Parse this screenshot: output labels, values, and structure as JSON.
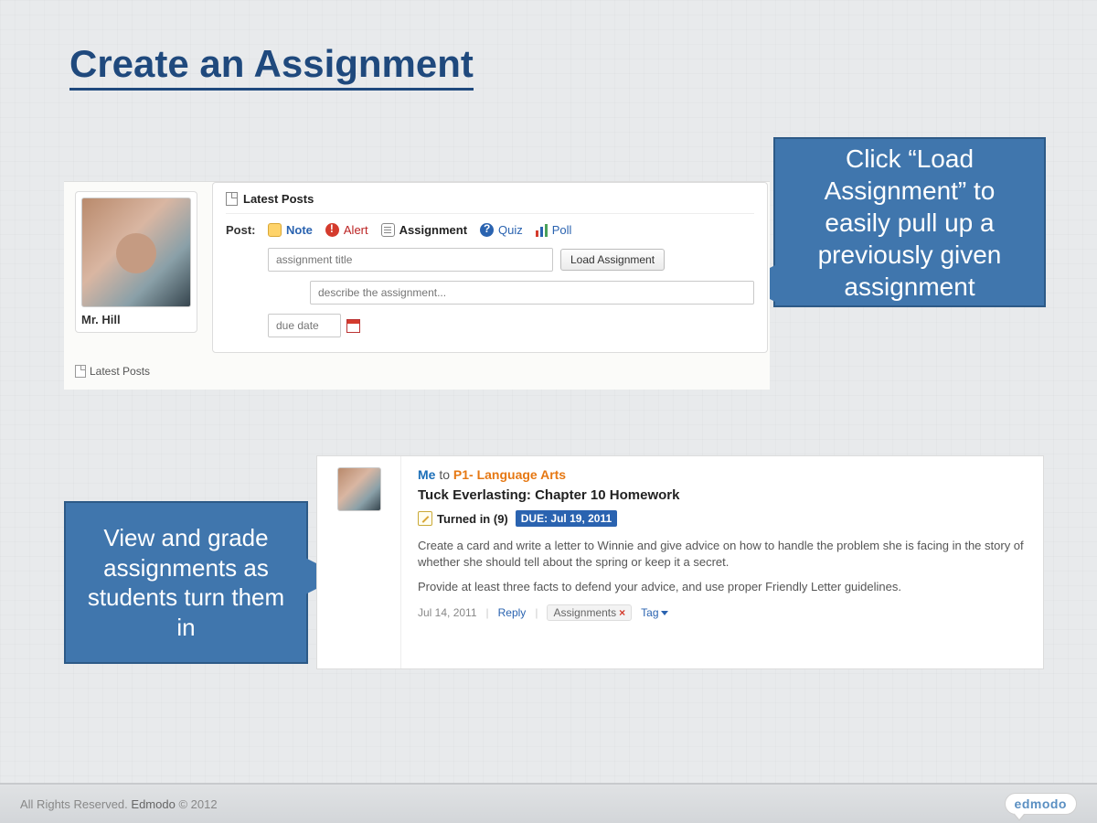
{
  "slide": {
    "title": "Create an Assignment"
  },
  "callouts": {
    "load": "Click “Load Assignment” to easily pull up a previously given assignment",
    "view": "View and grade assignments as students turn them in"
  },
  "profile": {
    "name": "Mr. Hill",
    "latest_posts_label": "Latest Posts"
  },
  "composer": {
    "header": "Latest Posts",
    "post_label": "Post:",
    "tabs": {
      "note": "Note",
      "alert": "Alert",
      "assignment": "Assignment",
      "quiz": "Quiz",
      "poll": "Poll"
    },
    "title_placeholder": "assignment title",
    "load_button": "Load Assignment",
    "describe_placeholder": "describe the assignment...",
    "due_placeholder": "due date"
  },
  "post": {
    "me_label": "Me",
    "to_label": "to",
    "group": "P1- Language Arts",
    "assignment_title": "Tuck Everlasting: Chapter 10 Homework",
    "turned_in": "Turned in (9)",
    "due_badge": "DUE: Jul 19, 2011",
    "body1": "Create a card and write a letter to Winnie and give advice on how to handle the problem she is facing in the story of whether she should tell about the spring or keep it a secret.",
    "body2": "Provide at least three facts to defend your advice, and use proper Friendly Letter guidelines.",
    "posted_date": "Jul 14, 2011",
    "reply": "Reply",
    "assignments_pill": "Assignments",
    "tag": "Tag"
  },
  "footer": {
    "rights": "All Rights Reserved.",
    "brand": "Edmodo",
    "copyright": "© 2012",
    "logo": "edmodo"
  }
}
